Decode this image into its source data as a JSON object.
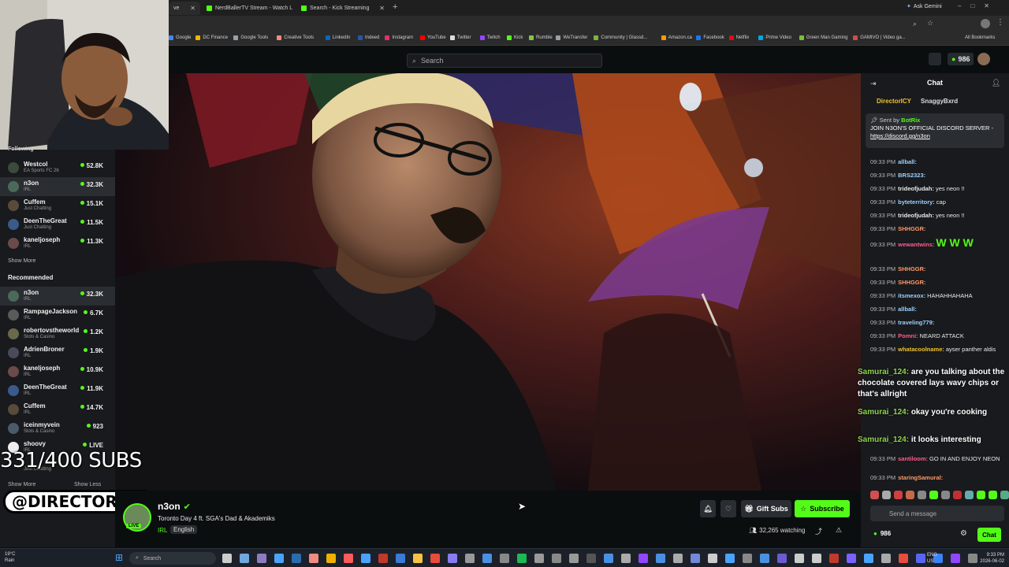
{
  "browser": {
    "tabs": [
      {
        "label": "ve"
      },
      {
        "label": "NerdBallerTV Stream - Watch L"
      },
      {
        "label": "Search - Kick Streaming"
      }
    ],
    "ask_gemini": "Ask Gemini",
    "bookmarks": [
      "Google",
      "DC Finance",
      "Google Tools",
      "Creative Tools",
      "LinkedIn",
      "Indeed",
      "Instagram",
      "YouTube",
      "Twitter",
      "Twitch",
      "Kick",
      "Rumble",
      "WeTransfer",
      "Community | Glassd...",
      "Amazon.ca",
      "Facebook",
      "Netflix",
      "Prime Video",
      "Green Man Gaming",
      "GAMIVO | Video ga..."
    ],
    "all_bookmarks": "All Bookmarks"
  },
  "header": {
    "search_placeholder": "Search",
    "balance": "986"
  },
  "sidebar": {
    "following_title": "Following",
    "following": [
      {
        "name": "Westcol",
        "category": "EA Sports FC 26",
        "viewers": "52.8K"
      },
      {
        "name": "n3on",
        "category": "IRL",
        "viewers": "32.3K"
      },
      {
        "name": "Cuffem",
        "category": "Just Chatting",
        "viewers": "15.1K"
      },
      {
        "name": "DeenTheGreat",
        "category": "Just Chatting",
        "viewers": "11.5K"
      },
      {
        "name": "kaneljoseph",
        "category": "IRL",
        "viewers": "11.3K"
      }
    ],
    "show_more_1": "Show More",
    "recommended_title": "Recommended",
    "recommended": [
      {
        "name": "n3on",
        "category": "IRL",
        "viewers": "32.3K"
      },
      {
        "name": "RampageJackson",
        "category": "IRL",
        "viewers": "6.7K"
      },
      {
        "name": "robertovstheworld",
        "category": "Slots & Casino",
        "viewers": "1.2K"
      },
      {
        "name": "AdrienBroner",
        "category": "IRL",
        "viewers": "1.9K"
      },
      {
        "name": "kaneljoseph",
        "category": "IRL",
        "viewers": "10.9K"
      },
      {
        "name": "DeenTheGreat",
        "category": "IRL",
        "viewers": "11.9K"
      },
      {
        "name": "Cuffem",
        "category": "IRL",
        "viewers": "14.7K"
      },
      {
        "name": "iceinmyvein",
        "category": "Slots & Casino",
        "viewers": "923"
      },
      {
        "name": "shoovy",
        "category": "IRL",
        "viewers": "LIVE"
      },
      {
        "name": "",
        "category": "Just Chatting",
        "viewers": ""
      }
    ],
    "show_more_2": "Show More",
    "show_less": "Show Less"
  },
  "overlay": {
    "subs_text": "331/400 SUBS",
    "handle": "@DIRECTORICY"
  },
  "channel": {
    "name": "n3on",
    "title": "Toronto Day 4 ft. SGA's Dad & Akademiks",
    "category": "IRL",
    "language": "English",
    "gift_subs": "Gift Subs",
    "subscribe": "Subscribe",
    "watching": "32,265 watching",
    "live_badge": "LIVE"
  },
  "chat": {
    "title": "Chat",
    "top_gifters": [
      "DirectorICY",
      "SnaggyBxrd"
    ],
    "pinned_sender_label": "Sent by",
    "pinned_sender": "BotRix",
    "pinned_text": "JOIN N3ON'S OFFICIAL DISCORD SERVER - ",
    "pinned_link": "https://discord.gg/n3on",
    "messages": [
      {
        "time": "09:33 PM",
        "user": "allball:",
        "text": "",
        "color": "#9ed0ff"
      },
      {
        "time": "09:33 PM",
        "user": "BRS2323:",
        "text": "",
        "color": "#9ed0ff"
      },
      {
        "time": "09:33 PM",
        "user": "trideofjudah:",
        "text": "yes neon !!",
        "color": "#e8e8e8"
      },
      {
        "time": "09:33 PM",
        "user": "byteterritory:",
        "text": "cap",
        "color": "#9ed0ff"
      },
      {
        "time": "09:33 PM",
        "user": "trideofjudah:",
        "text": "yes neon !!",
        "color": "#e8e8e8"
      },
      {
        "time": "09:33 PM",
        "user": "SHHGGR:",
        "text": "",
        "color": "#ff9966"
      },
      {
        "time": "09:33 PM",
        "user": "wewantwins:",
        "text": "W W W",
        "color": "#ff5c8a"
      },
      {
        "time": "09:33 PM",
        "user": "SHHGGR:",
        "text": "",
        "color": "#ff9966"
      },
      {
        "time": "09:33 PM",
        "user": "SHHGGR:",
        "text": "",
        "color": "#ff9966"
      },
      {
        "time": "09:33 PM",
        "user": "itsmexox:",
        "text": "HAHAHHAHAHA",
        "color": "#9ed0ff"
      },
      {
        "time": "09:33 PM",
        "user": "allball:",
        "text": "",
        "color": "#9ed0ff"
      },
      {
        "time": "09:33 PM",
        "user": "traveling779:",
        "text": "",
        "color": "#9ed0ff"
      },
      {
        "time": "09:33 PM",
        "user": "Pomni:",
        "text": "NEARD ATTACK",
        "color": "#ff5c8a"
      },
      {
        "time": "09:33 PM",
        "user": "whatacoolname:",
        "text": "ayser panther aldis",
        "color": "#f2c230"
      }
    ],
    "big_messages": [
      {
        "user": "Samurai_124:",
        "text": "are you talking about the chocolate covered lays wavy chips or that's allright"
      },
      {
        "user": "Samurai_124:",
        "text": "okay you're cooking"
      },
      {
        "user": "Samurai_124:",
        "text": "it looks interesting"
      }
    ],
    "more_messages": [
      {
        "time": "09:33 PM",
        "user": "santiloom:",
        "text": "GO IN AND ENJOY NEON",
        "color": "#ff5c8a"
      },
      {
        "time": "09:33 PM",
        "user": "staringSamural:",
        "text": "",
        "color": "#ff9966"
      }
    ],
    "input_placeholder": "Send a message",
    "balance": "986",
    "chat_button": "Chat"
  },
  "taskbar": {
    "weather_temp": "19°C",
    "weather_cond": "Rain",
    "search": "Search",
    "lang": "ENG",
    "region": "US",
    "time": "9:33 PM",
    "date": "2026-06-02"
  }
}
